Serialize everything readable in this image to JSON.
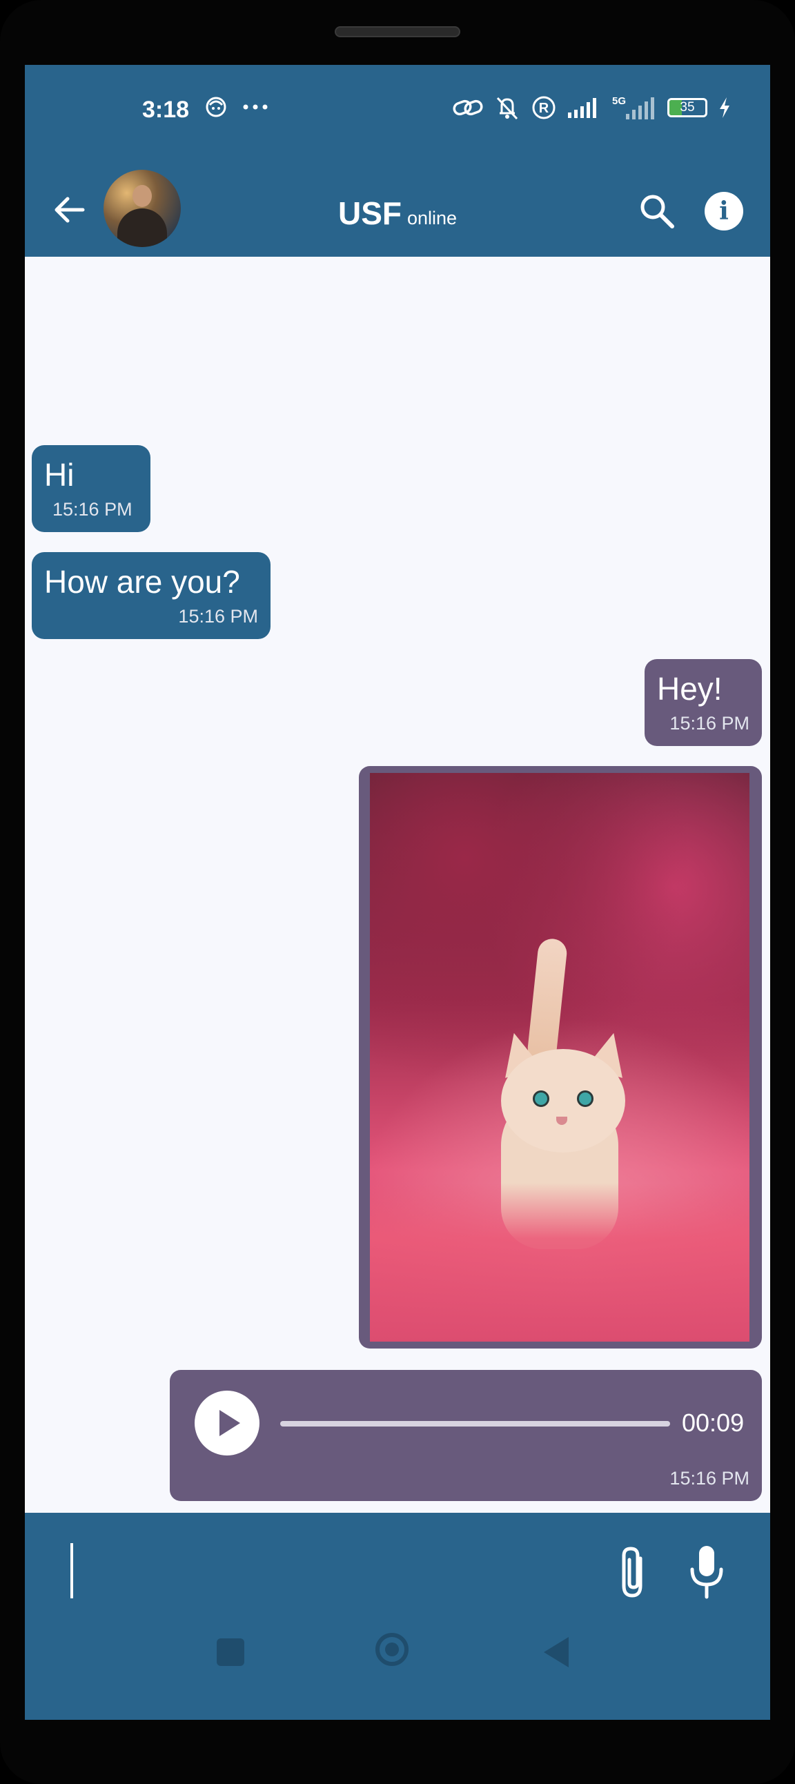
{
  "status_bar": {
    "time": "3:18",
    "battery_level": "35",
    "battery_fill_fraction": 0.35,
    "network": "5G",
    "icons": [
      "face-icon",
      "more-dots-icon",
      "link-icon",
      "bell-off-icon",
      "registered-icon",
      "signal-icon",
      "signal-5g-icon",
      "battery-icon",
      "charging-icon"
    ]
  },
  "header": {
    "contact_name": "USF",
    "status": "online",
    "icons": [
      "back-arrow-icon",
      "avatar",
      "search-icon",
      "info-icon"
    ],
    "info_glyph": "i"
  },
  "messages": [
    {
      "direction": "incoming",
      "text": "Hi",
      "time": "15:16 PM"
    },
    {
      "direction": "incoming",
      "text": "How are you?",
      "time": "15:16 PM"
    },
    {
      "direction": "outgoing",
      "text": "Hey!",
      "time": "15:16 PM"
    },
    {
      "direction": "outgoing",
      "type": "image",
      "subject": "kitten-photo"
    },
    {
      "direction": "outgoing",
      "type": "audio",
      "duration": "00:09",
      "progress_fraction": 0.0,
      "time": "15:16 PM"
    }
  ],
  "composer": {
    "value": "",
    "placeholder": "",
    "icons": [
      "attach-icon",
      "mic-icon"
    ]
  },
  "colors": {
    "primary": "#29648c",
    "incoming_bubble": "#29648c",
    "outgoing_bubble": "#685a7c",
    "chat_background": "#f7f8fd",
    "battery_green": "#4caf50"
  }
}
